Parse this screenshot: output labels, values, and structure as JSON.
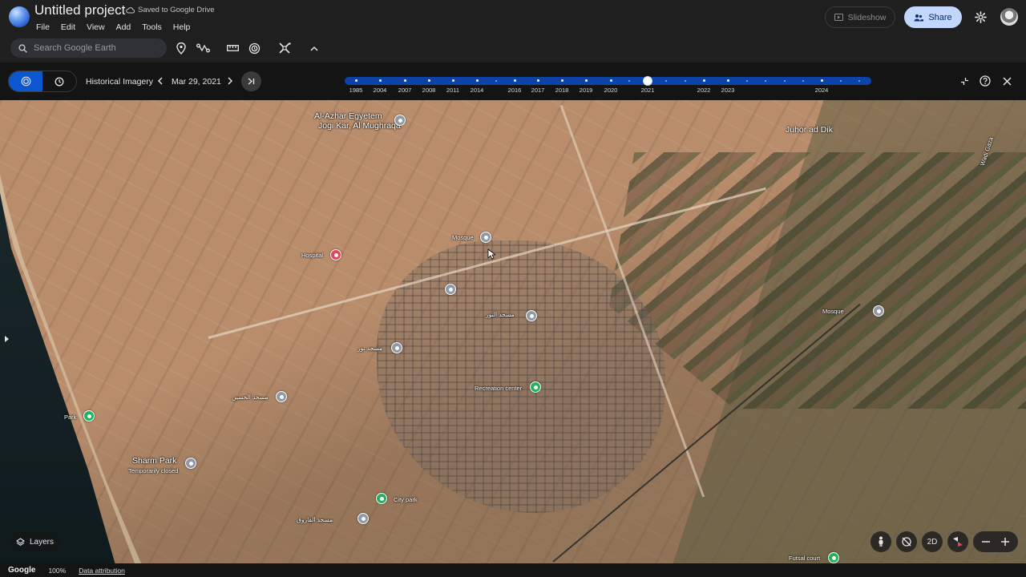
{
  "app": {
    "project_title": "Untitled project",
    "save_status": "Saved to Google Drive",
    "menu": [
      "File",
      "Edit",
      "View",
      "Add",
      "Tools",
      "Help"
    ],
    "slideshow_label": "Slideshow",
    "share_label": "Share"
  },
  "toolbar": {
    "search_placeholder": "Search Google Earth",
    "tools": [
      "placemark-icon",
      "path-icon",
      "ruler-icon",
      "historical-imagery-icon",
      "satellite-tools-icon",
      "chevron-up-icon"
    ]
  },
  "historical_imagery": {
    "label": "Historical Imagery",
    "current_date": "Mar 29, 2021",
    "selected_year": "2021",
    "years": [
      "1985",
      "2004",
      "2007",
      "2008",
      "2011",
      "2014",
      "2016",
      "2017",
      "2018",
      "2019",
      "2020",
      "2021",
      "2022",
      "2023",
      "2024"
    ]
  },
  "map": {
    "labels": {
      "al_azhar": "Al-Azhar Egyetem",
      "jogi_kar": "Jogi Kar, Al Mughraqa",
      "juhor": "Juhor ad Dik",
      "mosque_1": "Mosque",
      "hospital": "Hospital",
      "arabic_1": "مسجد النور",
      "arabic_2": "مسجد نور",
      "recreation": "Recreation center",
      "arabic_3": "مسجد الحسين",
      "park": "Park",
      "sharm_park": "Sharm Park",
      "temporarily_closed": "Temporarily closed",
      "city_park": "City park",
      "arabic_4": "مسجد الفاروق",
      "mosque_2": "Mosque",
      "futsal": "Futsal court",
      "road_label": "Wadi Gaza"
    },
    "pin_colors": {
      "poi": "#8f9aa6",
      "hospital": "#e8445a",
      "park": "#24b35c"
    }
  },
  "bottom": {
    "layers_label": "Layers",
    "view_2d_label": "2D",
    "google": "Google",
    "zoom": "100%",
    "attribution": "Data attribution"
  }
}
